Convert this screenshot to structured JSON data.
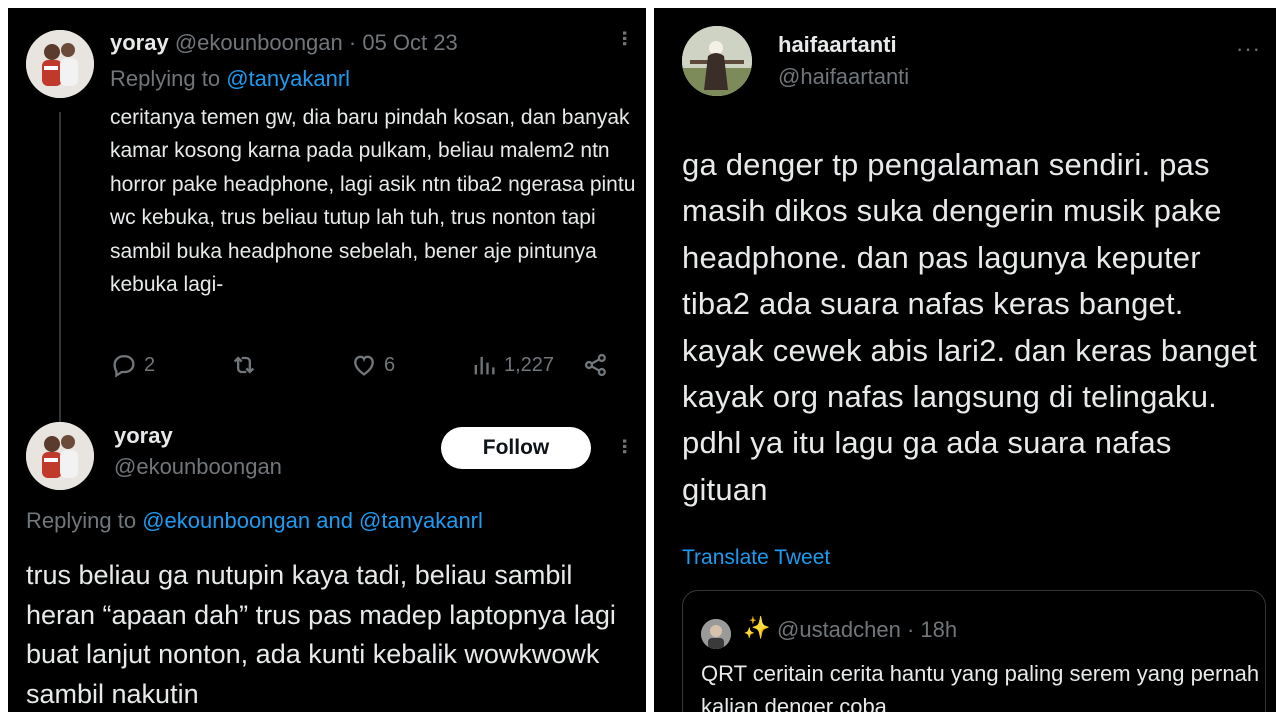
{
  "left_tweet": {
    "display_name": "yoray",
    "handle": "@ekounboongan",
    "date": "· 05 Oct 23",
    "replying_label": "Replying to",
    "replying_to": "@tanyakanrl",
    "body": "ceritanya temen gw, dia baru pindah kosan, dan banyak kamar kosong karna pada pulkam, beliau malem2 ntn horror pake headphone, lagi asik ntn tiba2 ngerasa pintu wc kebuka, trus beliau tutup lah tuh, trus nonton tapi sambil buka headphone sebelah, bener aje pintunya kebuka lagi-",
    "replies": "2",
    "retweets": "",
    "likes": "6",
    "views": "1,227"
  },
  "left_reply": {
    "display_name": "yoray",
    "handle": "@ekounboongan",
    "follow_label": "Follow",
    "replying_label": "Replying to",
    "replying_to": "@ekounboongan and @tanyakanrl",
    "body": "trus beliau ga nutupin kaya tadi, beliau sambil heran “apaan dah” trus pas madep laptopnya lagi buat lanjut nonton, ada kunti kebalik wowkwowk sambil nakutin"
  },
  "right_tweet": {
    "display_name": "haifaartanti",
    "handle": "@haifaartanti",
    "body": "ga denger tp pengalaman sendiri. pas masih dikos suka dengerin musik pake headphone. dan pas lagunya keputer tiba2 ada suara nafas keras banget. kayak cewek abis lari2. dan keras banget kayak org nafas langsung di telingaku. pdhl ya itu lagu ga ada suara nafas gituan",
    "translate_label": "Translate Tweet",
    "quoted": {
      "sparkle": "✨",
      "handle": "@ustadchen · 18h",
      "body": "QRT ceritain cerita hantu yang paling serem yang pernah kalian denger coba"
    }
  },
  "colors": {
    "background": "#000000",
    "text": "#e7e9ea",
    "secondary": "#71767b",
    "link": "#1d9bf0",
    "follow_bg": "#ffffff"
  }
}
